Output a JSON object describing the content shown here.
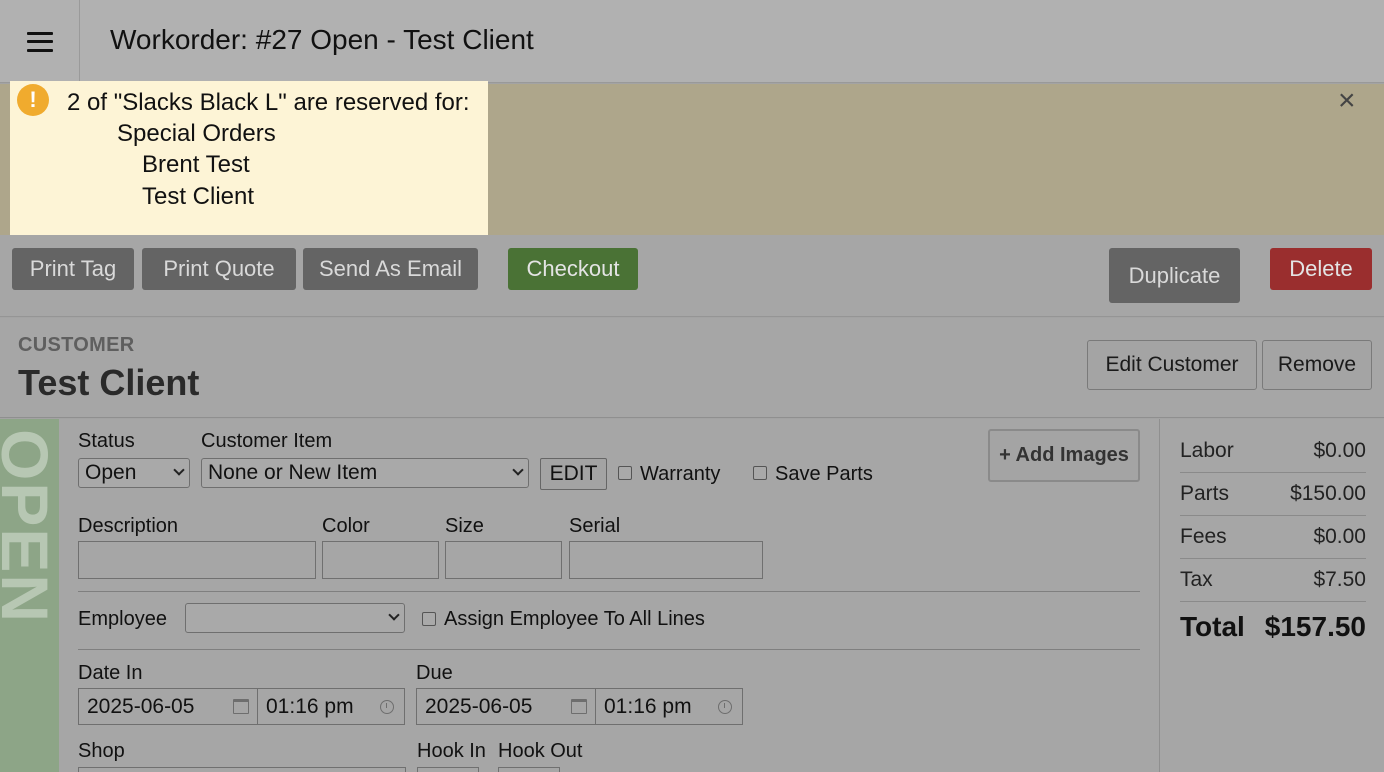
{
  "header": {
    "title": "Workorder:  #27 Open - Test Client"
  },
  "alert": {
    "line1": "2 of \"Slacks Black L\" are reserved for:",
    "line2": "Special Orders",
    "line3": "Brent Test",
    "line4": "Test Client",
    "close": "×"
  },
  "toolbar": {
    "print_tag": "Print Tag",
    "print_quote": "Print Quote",
    "send_email": "Send As Email",
    "checkout": "Checkout",
    "duplicate": "Duplicate",
    "delete": "Delete"
  },
  "customer": {
    "label": "CUSTOMER",
    "name": "Test Client",
    "edit": "Edit Customer",
    "remove": "Remove"
  },
  "status_strip": "OPEN",
  "form": {
    "status_label": "Status",
    "status_value": "Open",
    "customer_item_label": "Customer Item",
    "customer_item_value": "None or New Item",
    "edit_btn": "EDIT",
    "warranty": "Warranty",
    "save_parts": "Save Parts",
    "add_images": "+ Add Images",
    "description_label": "Description",
    "color_label": "Color",
    "size_label": "Size",
    "serial_label": "Serial",
    "employee_label": "Employee",
    "employee_value": "",
    "assign_all": "Assign Employee To All Lines",
    "date_in_label": "Date In",
    "date_in": "2025-06-05",
    "time_in": "01:16 pm",
    "due_label": "Due",
    "due_date": "2025-06-05",
    "due_time": "01:16 pm",
    "shop_label": "Shop",
    "hook_in_label": "Hook In",
    "hook_out_label": "Hook Out"
  },
  "totals": [
    {
      "label": "Labor",
      "value": "$0.00"
    },
    {
      "label": "Parts",
      "value": "$150.00"
    },
    {
      "label": "Fees",
      "value": "$0.00"
    },
    {
      "label": "Tax",
      "value": "$7.50"
    },
    {
      "label": "Total",
      "value": "$157.50"
    }
  ],
  "colors": {
    "checkout": "#4a7235",
    "delete": "#9a2e2e",
    "alert_bg": "#fdf4d6",
    "alert_icon": "#f0ab2e",
    "status_strip": "#8da587"
  }
}
